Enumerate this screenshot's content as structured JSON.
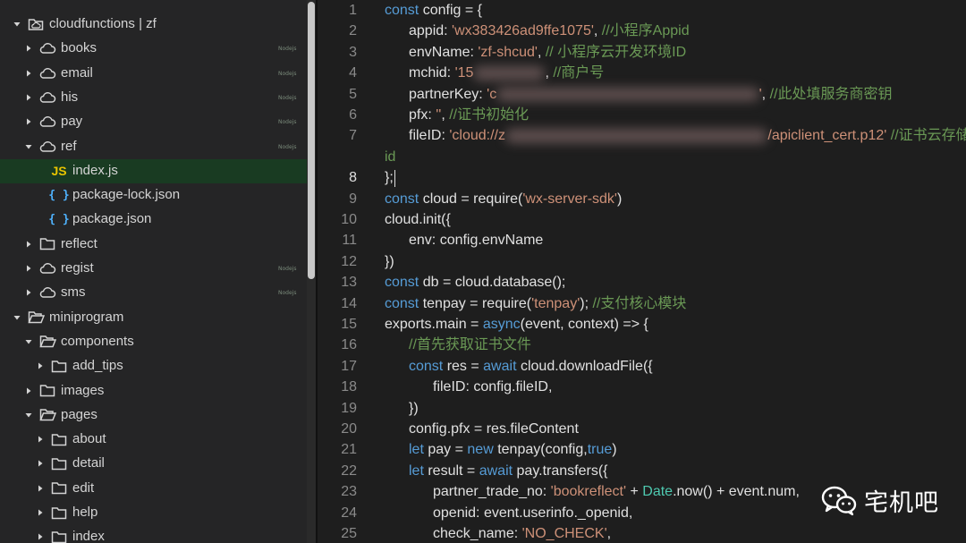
{
  "sidebar": {
    "items": [
      {
        "label": "cloudfunctions | zf",
        "icon": "cloud-folder-icon",
        "depth": 0,
        "expanded": true,
        "badge": ""
      },
      {
        "label": "books",
        "icon": "cloud-icon",
        "depth": 1,
        "expanded": false,
        "badge": "Nodejs"
      },
      {
        "label": "email",
        "icon": "cloud-icon",
        "depth": 1,
        "expanded": false,
        "badge": "Nodejs"
      },
      {
        "label": "his",
        "icon": "cloud-icon",
        "depth": 1,
        "expanded": false,
        "badge": "Nodejs"
      },
      {
        "label": "pay",
        "icon": "cloud-icon",
        "depth": 1,
        "expanded": false,
        "badge": "Nodejs"
      },
      {
        "label": "ref",
        "icon": "cloud-icon",
        "depth": 1,
        "expanded": true,
        "badge": "Nodejs"
      },
      {
        "label": "index.js",
        "icon": "js-file-icon",
        "depth": 2,
        "selected": true,
        "badge": ""
      },
      {
        "label": "package-lock.json",
        "icon": "json-file-icon",
        "depth": 2,
        "badge": ""
      },
      {
        "label": "package.json",
        "icon": "json-file-icon",
        "depth": 2,
        "badge": ""
      },
      {
        "label": "reflect",
        "icon": "folder-icon",
        "depth": 1,
        "expanded": false,
        "badge": ""
      },
      {
        "label": "regist",
        "icon": "cloud-icon",
        "depth": 1,
        "expanded": false,
        "badge": "Nodejs"
      },
      {
        "label": "sms",
        "icon": "cloud-icon",
        "depth": 1,
        "expanded": false,
        "badge": "Nodejs"
      },
      {
        "label": "miniprogram",
        "icon": "folder-open-icon",
        "depth": 0,
        "expanded": true,
        "badge": ""
      },
      {
        "label": "components",
        "icon": "folder-open-icon",
        "depth": 1,
        "expanded": true,
        "badge": ""
      },
      {
        "label": "add_tips",
        "icon": "folder-icon",
        "depth": 2,
        "expanded": false,
        "badge": ""
      },
      {
        "label": "images",
        "icon": "folder-icon",
        "depth": 1,
        "expanded": false,
        "badge": ""
      },
      {
        "label": "pages",
        "icon": "folder-open-icon",
        "depth": 1,
        "expanded": true,
        "badge": ""
      },
      {
        "label": "about",
        "icon": "folder-icon",
        "depth": 2,
        "expanded": false,
        "badge": ""
      },
      {
        "label": "detail",
        "icon": "folder-icon",
        "depth": 2,
        "expanded": false,
        "badge": ""
      },
      {
        "label": "edit",
        "icon": "folder-icon",
        "depth": 2,
        "expanded": false,
        "badge": ""
      },
      {
        "label": "help",
        "icon": "folder-icon",
        "depth": 2,
        "expanded": false,
        "badge": ""
      },
      {
        "label": "index",
        "icon": "folder-icon",
        "depth": 2,
        "expanded": false,
        "badge": ""
      }
    ]
  },
  "editor": {
    "active_line": 8,
    "lines": [
      {
        "n": 1,
        "indent": 0,
        "tokens": [
          [
            "kw",
            "const"
          ],
          [
            "plain",
            " config = {"
          ]
        ]
      },
      {
        "n": 2,
        "indent": 1,
        "tokens": [
          [
            "plain",
            "appid: "
          ],
          [
            "str",
            "'wx383426ad9ffe1075'"
          ],
          [
            "plain",
            ", "
          ],
          [
            "cm",
            "//小程序Appid"
          ]
        ]
      },
      {
        "n": 3,
        "indent": 1,
        "tokens": [
          [
            "plain",
            "envName: "
          ],
          [
            "str",
            "'zf-shcud'"
          ],
          [
            "plain",
            ", "
          ],
          [
            "cm",
            "// 小程序云开发环境ID"
          ]
        ]
      },
      {
        "n": 4,
        "indent": 1,
        "tokens": [
          [
            "plain",
            "mchid: "
          ],
          [
            "str",
            "'15"
          ],
          [
            "blank",
            "                  "
          ],
          [
            "plain",
            ", "
          ],
          [
            "cm",
            "//商户号"
          ]
        ]
      },
      {
        "n": 5,
        "indent": 1,
        "tokens": [
          [
            "plain",
            "partnerKey: "
          ],
          [
            "str",
            "'c"
          ],
          [
            "blank",
            "                                                                  "
          ],
          [
            "str",
            "'"
          ],
          [
            "plain",
            ", "
          ],
          [
            "cm",
            "//此处填服务商密钥"
          ]
        ]
      },
      {
        "n": 6,
        "indent": 1,
        "tokens": [
          [
            "plain",
            "pfx: "
          ],
          [
            "str",
            "''"
          ],
          [
            "plain",
            ", "
          ],
          [
            "cm",
            "//证书初始化"
          ]
        ]
      },
      {
        "n": 7,
        "indent": 1,
        "tokens": [
          [
            "plain",
            "fileID: "
          ],
          [
            "str",
            "'cloud://z"
          ],
          [
            "blank",
            "                                                                  "
          ],
          [
            "str",
            "/apiclient_cert.p12'"
          ],
          [
            "plain",
            " "
          ],
          [
            "cm",
            "//证书云存储"
          ]
        ]
      },
      {
        "n": null,
        "indent": 0,
        "tokens": [
          [
            "cm",
            "id"
          ]
        ]
      },
      {
        "n": 8,
        "indent": 0,
        "tokens": [
          [
            "plain",
            "};"
          ]
        ]
      },
      {
        "n": 9,
        "indent": 0,
        "tokens": [
          [
            "kw",
            "const"
          ],
          [
            "plain",
            " cloud = require("
          ],
          [
            "str",
            "'wx-server-sdk'"
          ],
          [
            "plain",
            ")"
          ]
        ]
      },
      {
        "n": 10,
        "indent": 0,
        "tokens": [
          [
            "plain",
            "cloud.init({"
          ]
        ]
      },
      {
        "n": 11,
        "indent": 1,
        "tokens": [
          [
            "plain",
            "env: config.envName"
          ]
        ]
      },
      {
        "n": 12,
        "indent": 0,
        "tokens": [
          [
            "plain",
            "})"
          ]
        ]
      },
      {
        "n": 13,
        "indent": 0,
        "tokens": [
          [
            "kw",
            "const"
          ],
          [
            "plain",
            " db = cloud.database();"
          ]
        ]
      },
      {
        "n": 14,
        "indent": 0,
        "tokens": [
          [
            "kw",
            "const"
          ],
          [
            "plain",
            " tenpay = require("
          ],
          [
            "str",
            "'tenpay'"
          ],
          [
            "plain",
            "); "
          ],
          [
            "cm",
            "//支付核心模块"
          ]
        ]
      },
      {
        "n": 15,
        "indent": 0,
        "tokens": [
          [
            "plain",
            "exports.main = "
          ],
          [
            "kw",
            "async"
          ],
          [
            "plain",
            "(event, context) => {"
          ]
        ]
      },
      {
        "n": 16,
        "indent": 1,
        "tokens": [
          [
            "cm",
            "//首先获取证书文件"
          ]
        ]
      },
      {
        "n": 17,
        "indent": 1,
        "tokens": [
          [
            "kw",
            "const"
          ],
          [
            "plain",
            " res = "
          ],
          [
            "kw",
            "await"
          ],
          [
            "plain",
            " cloud.downloadFile({"
          ]
        ]
      },
      {
        "n": 18,
        "indent": 2,
        "tokens": [
          [
            "plain",
            "fileID: config.fileID,"
          ]
        ]
      },
      {
        "n": 19,
        "indent": 1,
        "tokens": [
          [
            "plain",
            "})"
          ]
        ]
      },
      {
        "n": 20,
        "indent": 1,
        "tokens": [
          [
            "plain",
            "config.pfx = res.fileContent"
          ]
        ]
      },
      {
        "n": 21,
        "indent": 1,
        "tokens": [
          [
            "kw",
            "let"
          ],
          [
            "plain",
            " pay = "
          ],
          [
            "kw",
            "new"
          ],
          [
            "plain",
            " tenpay(config,"
          ],
          [
            "kw",
            "true"
          ],
          [
            "plain",
            ")"
          ]
        ]
      },
      {
        "n": 22,
        "indent": 1,
        "tokens": [
          [
            "kw",
            "let"
          ],
          [
            "plain",
            " result = "
          ],
          [
            "kw",
            "await"
          ],
          [
            "plain",
            " pay.transfers({"
          ]
        ]
      },
      {
        "n": 23,
        "indent": 2,
        "tokens": [
          [
            "plain",
            "partner_trade_no: "
          ],
          [
            "str",
            "'bookreflect'"
          ],
          [
            "plain",
            " + "
          ],
          [
            "ty",
            "Date"
          ],
          [
            "plain",
            ".now() + event.num,"
          ]
        ]
      },
      {
        "n": 24,
        "indent": 2,
        "tokens": [
          [
            "plain",
            "openid: event.userinfo._openid,"
          ]
        ]
      },
      {
        "n": 25,
        "indent": 2,
        "tokens": [
          [
            "plain",
            "check_name: "
          ],
          [
            "str",
            "'NO_CHECK'"
          ],
          [
            "plain",
            ","
          ]
        ]
      }
    ]
  },
  "watermark": {
    "text": "宅机吧",
    "icon": "wechat-icon"
  },
  "colors": {
    "keyword": "#569cd6",
    "string": "#ce9178",
    "comment": "#6a9955",
    "selected_row": "#193b22",
    "js_icon": "#e8c400",
    "json_icon": "#4fb3ff"
  }
}
